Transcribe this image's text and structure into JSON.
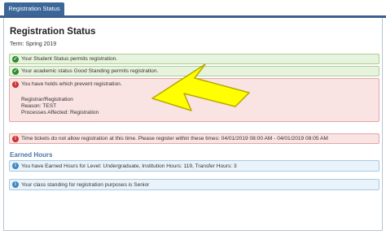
{
  "tab": {
    "label": "Registration Status"
  },
  "page": {
    "title": "Registration Status",
    "term": "Term: Spring 2019"
  },
  "messages": {
    "student_status": "Your Student Status permits registration.",
    "academic_status": "Your academic status Good Standing permits registration.",
    "holds": {
      "text": "You have holds which prevent registration.",
      "hold_name": "Registrar/Registration",
      "reason": "Reason: TEST",
      "processes": "Processes Affected: Registration"
    },
    "time_ticket": "Time tickets do not allow registration at this time. Please register within these times: 04/01/2019 08:00 AM - 04/01/2019 08:05 AM"
  },
  "earned_hours": {
    "heading": "Earned Hours",
    "hours_text": "You have Earned Hours for Level: Undergraduate, Institution Hours: 119, Transfer Hours: 3",
    "standing_text": "Your class standing for registration purposes is Senior"
  },
  "icons": {
    "success": "check-icon",
    "error": "exclamation-icon",
    "info": "info-icon"
  },
  "colors": {
    "accent": "#3d6799",
    "success_bg": "#e8f3df",
    "error_bg": "#f9e3e3",
    "info_bg": "#eaf3fa",
    "arrow": "#ffff00"
  }
}
